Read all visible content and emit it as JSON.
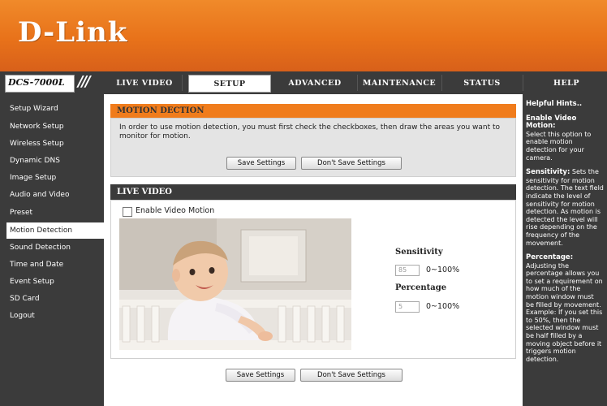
{
  "brand": {
    "logo_text": "D-Link",
    "model": "DCS-7000L",
    "accent": "#f07c1c",
    "dark": "#3b3b3b"
  },
  "nav": {
    "tabs": [
      {
        "label": "LIVE VIDEO"
      },
      {
        "label": "SETUP"
      },
      {
        "label": "ADVANCED"
      },
      {
        "label": "MAINTENANCE"
      },
      {
        "label": "STATUS"
      },
      {
        "label": "HELP"
      }
    ],
    "active": "SETUP"
  },
  "sidebar": {
    "items": [
      {
        "label": "Setup Wizard"
      },
      {
        "label": "Network Setup"
      },
      {
        "label": "Wireless Setup"
      },
      {
        "label": "Dynamic DNS"
      },
      {
        "label": "Image Setup"
      },
      {
        "label": "Audio and Video"
      },
      {
        "label": "Preset"
      },
      {
        "label": "Motion Detection"
      },
      {
        "label": "Sound Detection"
      },
      {
        "label": "Time and Date"
      },
      {
        "label": "Event Setup"
      },
      {
        "label": "SD Card"
      },
      {
        "label": "Logout"
      }
    ],
    "active": "Motion Detection"
  },
  "motion": {
    "title": "MOTION DECTION",
    "description": "In order to use motion detection, you must first check the checkboxes, then draw the areas you want to monitor for motion.",
    "save_label": "Save Settings",
    "dont_save_label": "Don't Save Settings"
  },
  "live": {
    "title": "LIVE VIDEO",
    "enable_label": "Enable Video Motion",
    "enable_checked": false,
    "sensitivity_label": "Sensitivity",
    "sensitivity_value": "85",
    "sensitivity_range": "0~100%",
    "percentage_label": "Percentage",
    "percentage_value": "5",
    "percentage_range": "0~100%"
  },
  "footer_buttons": {
    "save_label": "Save Settings",
    "dont_save_label": "Don't Save Settings"
  },
  "hints": {
    "title": "Helpful Hints..",
    "h1": "Enable Video Motion:",
    "t1": "Select this option to enable motion detection for your camera.",
    "h2": "Sensitivity:",
    "t2": "Sets the sensitivity for motion detection. The text field indicate the level of sensitivity for motion detection. As motion is detected the level will rise depending on the frequency of the movement.",
    "h3": "Percentage:",
    "t3": "Adjusting the percentage allows you to set a requirement on how much of the motion window must be filled by movement. Example: If you set this to 50%, then the selected window must be half filled by a moving object before it triggers motion detection."
  }
}
